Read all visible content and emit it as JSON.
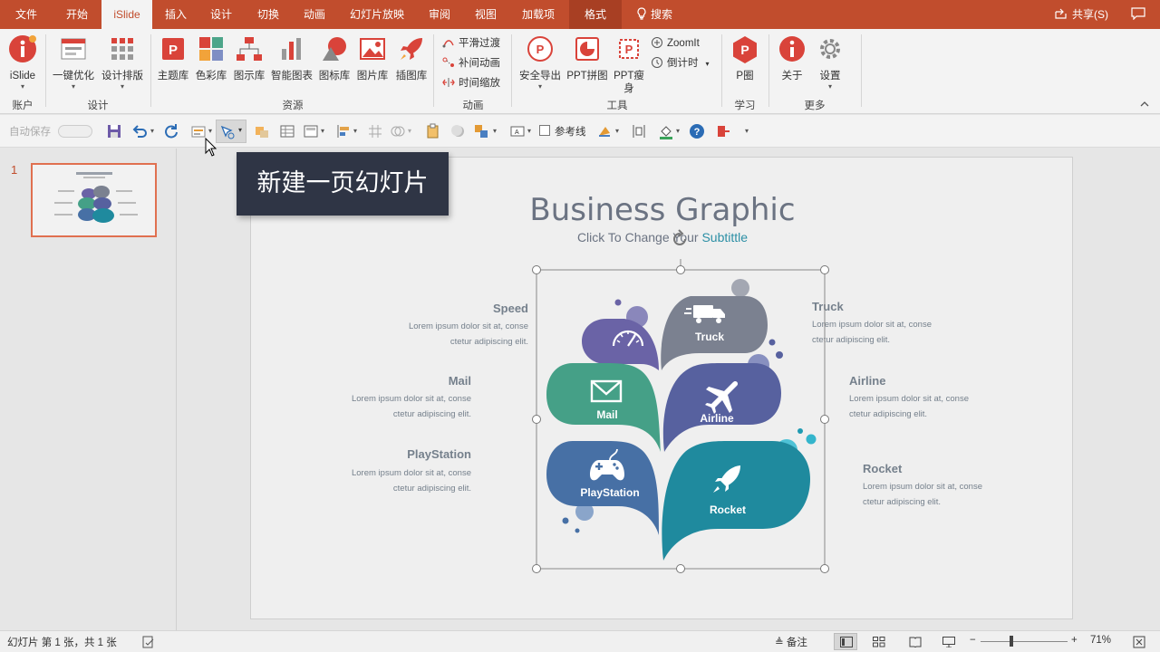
{
  "tabs": [
    "文件",
    "开始",
    "iSlide",
    "插入",
    "设计",
    "切换",
    "动画",
    "幻灯片放映",
    "审阅",
    "视图",
    "加载项",
    "格式"
  ],
  "active_tab": "iSlide",
  "search_label": "搜索",
  "share_label": "共享(S)",
  "ribbon": {
    "account_btn": "iSlide",
    "account_group": "账户",
    "design_btns": [
      "一键优化",
      "设计排版"
    ],
    "design_group": "设计",
    "resource_btns": [
      "主题库",
      "色彩库",
      "图示库",
      "智能图表",
      "图标库",
      "图片库",
      "插图库"
    ],
    "resource_group": "资源",
    "anim_btns": [
      "平滑过渡",
      "补间动画",
      "时间缩放"
    ],
    "anim_group": "动画",
    "tool_btns": [
      "安全导出",
      "PPT拼图",
      "PPT瘦身"
    ],
    "tool_small": [
      "ZoomIt",
      "倒计时"
    ],
    "tool_group": "工具",
    "learn_btn": "P圈",
    "learn_group": "学习",
    "more_btns": [
      "关于",
      "设置"
    ],
    "more_group": "更多"
  },
  "qat": {
    "autosave": "自动保存",
    "guides": "参考线"
  },
  "tooltip": "新建一页幻灯片",
  "slide_number": "1",
  "slide": {
    "title": "Business Graphic",
    "subtitle_pre": "Click To Change ",
    "subtitle_mid": "Your",
    "subtitle_post": " Subtittle",
    "items": [
      {
        "name": "Speed",
        "line1": "Lorem ipsum dolor sit at, conse",
        "line2": "ctetur adipiscing elit."
      },
      {
        "name": "Mail",
        "line1": "Lorem ipsum dolor sit at, conse",
        "line2": "ctetur adipiscing elit."
      },
      {
        "name": "PlayStation",
        "line1": "Lorem ipsum dolor sit at, conse",
        "line2": "ctetur adipiscing elit."
      },
      {
        "name": "Truck",
        "line1": "Lorem ipsum dolor sit at, conse",
        "line2": "ctetur adipiscing elit."
      },
      {
        "name": "Airline",
        "line1": "Lorem ipsum dolor sit at, conse",
        "line2": "ctetur adipiscing elit."
      },
      {
        "name": "Rocket",
        "line1": "Lorem ipsum dolor sit at, conse",
        "line2": "ctetur adipiscing elit."
      }
    ],
    "colors": {
      "speed": "#6a63a6",
      "truck": "#7b8190",
      "mail": "#45a087",
      "airline": "#57619f",
      "playstation": "#4770a5",
      "rocket": "#1f8a9e"
    }
  },
  "status": {
    "slide_info": "幻灯片 第 1 张，共 1 张",
    "notes": "备注",
    "zoom": "71%"
  }
}
